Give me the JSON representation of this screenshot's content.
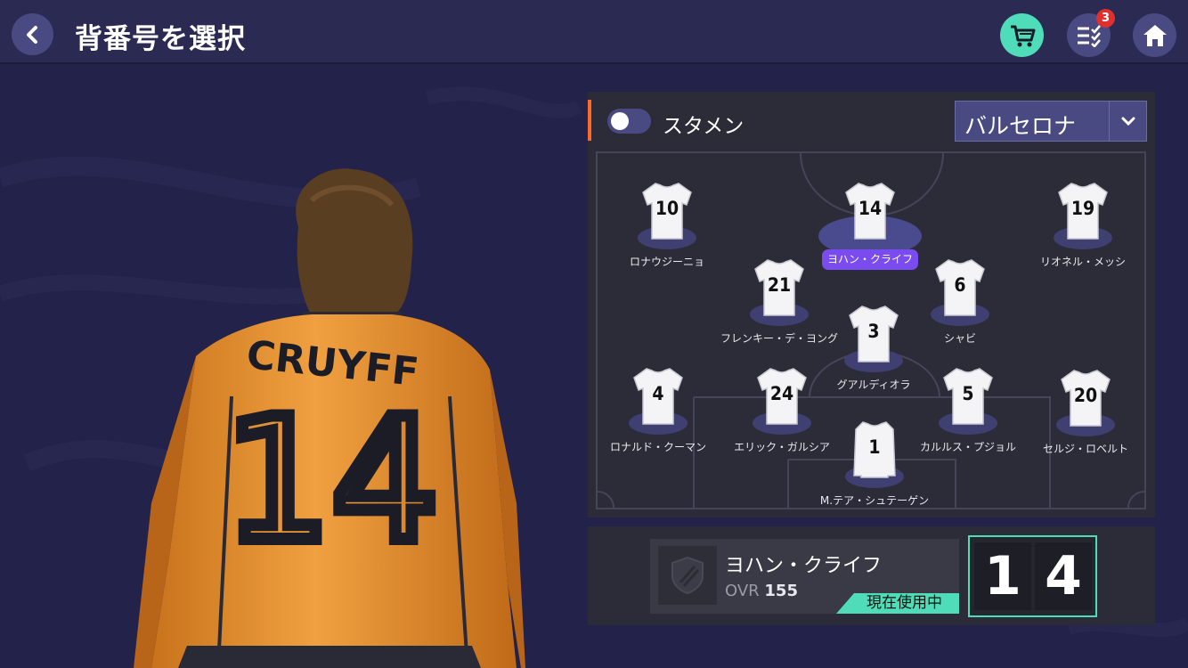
{
  "header": {
    "title": "背番号を選択",
    "notification_count": "3"
  },
  "filter": {
    "starting_label": "スタメン",
    "starting_on": false,
    "team": "バルセロナ"
  },
  "formation": {
    "selected_number": "14",
    "players": [
      {
        "number": "10",
        "name": "ロナウジーニョ"
      },
      {
        "number": "14",
        "name": "ヨハン・クライフ",
        "selected": true
      },
      {
        "number": "19",
        "name": "リオネル・メッシ"
      },
      {
        "number": "21",
        "name": "フレンキー・デ・ヨング"
      },
      {
        "number": "6",
        "name": "シャビ"
      },
      {
        "number": "3",
        "name": "グアルディオラ"
      },
      {
        "number": "4",
        "name": "ロナルド・クーマン"
      },
      {
        "number": "24",
        "name": "エリック・ガルシア"
      },
      {
        "number": "5",
        "name": "カルルス・プジョル"
      },
      {
        "number": "20",
        "name": "セルジ・ロベルト"
      },
      {
        "number": "1",
        "name": "M.テア・シュテーゲン"
      }
    ]
  },
  "selected_player": {
    "name": "ヨハン・クライフ",
    "ovr_label": "OVR",
    "ovr_value": "155",
    "status": "現在使用中",
    "digits": [
      "1",
      "4"
    ]
  },
  "player_art": {
    "jersey_name": "CRUYFF",
    "jersey_number": "14"
  },
  "colors": {
    "accent_green": "#4fdcb8",
    "accent_orange": "#ff6a2a",
    "selection_purple": "#7a4cf0",
    "badge_red": "#e0302e",
    "background": "#23224a"
  },
  "icons": {
    "back": "chevron-left-icon",
    "cart": "cart-icon",
    "list": "checklist-icon",
    "home": "home-icon",
    "dropdown": "chevron-down-icon",
    "crest": "shield-icon"
  }
}
